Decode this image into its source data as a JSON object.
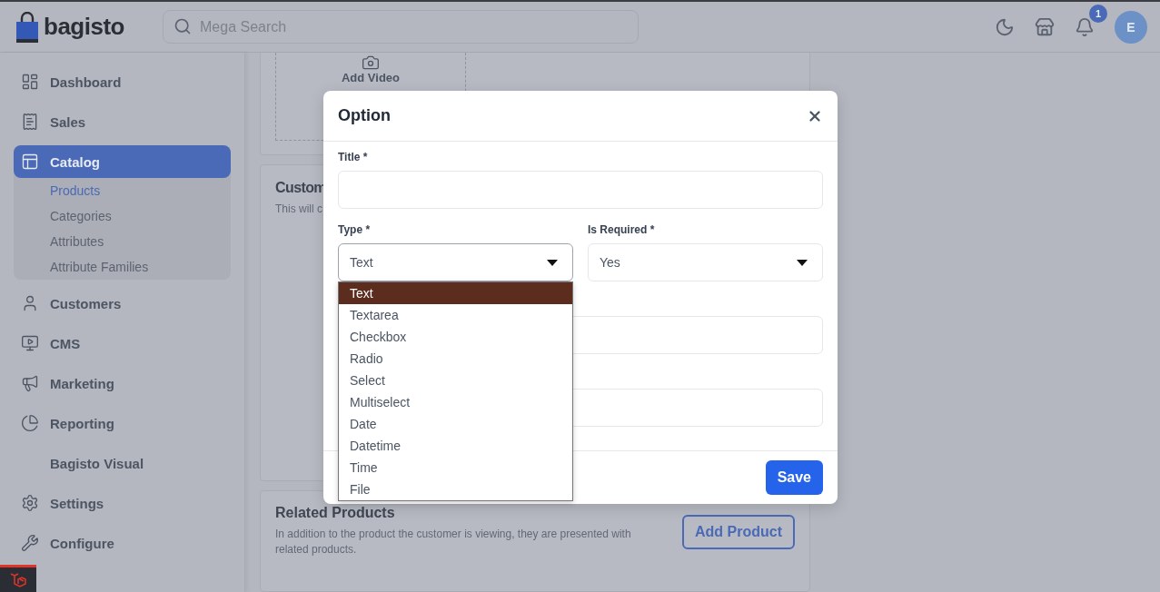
{
  "header": {
    "logo_text": "bagisto",
    "search": {
      "placeholder": "Mega Search"
    },
    "notification_count": "1",
    "avatar_letter": "E"
  },
  "sidebar": {
    "items": [
      {
        "label": "Dashboard",
        "selected": false
      },
      {
        "label": "Sales",
        "selected": false
      },
      {
        "label": "Catalog",
        "selected": true,
        "children": [
          {
            "label": "Products",
            "selected": true
          },
          {
            "label": "Categories",
            "selected": false
          },
          {
            "label": "Attributes",
            "selected": false
          },
          {
            "label": "Attribute Families",
            "selected": false
          }
        ]
      },
      {
        "label": "Customers",
        "selected": false
      },
      {
        "label": "CMS",
        "selected": false
      },
      {
        "label": "Marketing",
        "selected": false
      },
      {
        "label": "Reporting",
        "selected": false
      },
      {
        "label": "Bagisto Visual",
        "selected": false
      },
      {
        "label": "Settings",
        "selected": false
      },
      {
        "label": "Configure",
        "selected": false
      }
    ]
  },
  "content": {
    "media_card": {
      "add_video_label": "Add Video"
    },
    "custom_card": {
      "title": "Custom",
      "description": "This will c"
    },
    "related_card": {
      "title": "Related Products",
      "description": "In addition to the product the customer is viewing, they are presented with related products.",
      "button": "Add Product"
    }
  },
  "modal": {
    "title": "Option",
    "title_field": {
      "label": "Title *"
    },
    "type_field": {
      "label": "Type *",
      "value": "Text",
      "expanded": true,
      "options": [
        {
          "label": "Text",
          "selected": true
        },
        {
          "label": "Textarea",
          "selected": false
        },
        {
          "label": "Checkbox",
          "selected": false
        },
        {
          "label": "Radio",
          "selected": false
        },
        {
          "label": "Select",
          "selected": false
        },
        {
          "label": "Multiselect",
          "selected": false
        },
        {
          "label": "Date",
          "selected": false
        },
        {
          "label": "Datetime",
          "selected": false
        },
        {
          "label": "Time",
          "selected": false
        },
        {
          "label": "File",
          "selected": false
        }
      ]
    },
    "required_field": {
      "label": "Is Required *",
      "value": "Yes"
    },
    "more_fields": [
      {
        "kind": "text"
      },
      {
        "kind": "text"
      }
    ],
    "save_button": "Save"
  }
}
